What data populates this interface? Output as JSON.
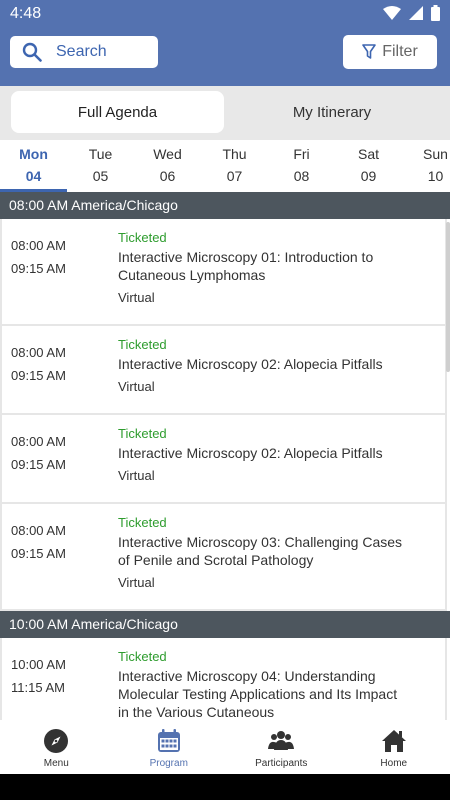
{
  "status_bar": {
    "time": "4:48"
  },
  "header": {
    "search_label": "Search",
    "filter_label": "Filter"
  },
  "segments": {
    "active": "Full Agenda",
    "inactive": "My Itinerary"
  },
  "days": [
    {
      "day": "Mon",
      "num": "04",
      "active": true
    },
    {
      "day": "Tue",
      "num": "05"
    },
    {
      "day": "Wed",
      "num": "06"
    },
    {
      "day": "Thu",
      "num": "07"
    },
    {
      "day": "Fri",
      "num": "08"
    },
    {
      "day": "Sat",
      "num": "09"
    },
    {
      "day": "Sun",
      "num": "10"
    }
  ],
  "groups": [
    {
      "header": "08:00 AM America/Chicago",
      "sessions": [
        {
          "start": "08:00 AM",
          "end": "09:15 AM",
          "status": "Ticketed",
          "title": "Interactive Microscopy 01: Introduction to Cutaneous Lymphomas",
          "location": "Virtual"
        },
        {
          "start": "08:00 AM",
          "end": "09:15 AM",
          "status": "Ticketed",
          "title": "Interactive Microscopy 02: Alopecia Pitfalls",
          "location": "Virtual"
        },
        {
          "start": "08:00 AM",
          "end": "09:15 AM",
          "status": "Ticketed",
          "title": "Interactive Microscopy 02: Alopecia Pitfalls",
          "location": "Virtual"
        },
        {
          "start": "08:00 AM",
          "end": "09:15 AM",
          "status": "Ticketed",
          "title": "Interactive Microscopy 03: Challenging Cases of Penile and Scrotal Pathology",
          "location": "Virtual"
        }
      ]
    },
    {
      "header": "10:00 AM America/Chicago",
      "sessions": [
        {
          "start": "10:00 AM",
          "end": "11:15 AM",
          "status": "Ticketed",
          "title": "Interactive Microscopy 04: Understanding Molecular Testing Applications and Its Impact in the Various Cutaneous",
          "location": ""
        }
      ]
    }
  ],
  "nav": [
    {
      "label": "Menu",
      "icon": "compass-icon"
    },
    {
      "label": "Program",
      "icon": "calendar-icon",
      "active": true
    },
    {
      "label": "Participants",
      "icon": "people-icon"
    },
    {
      "label": "Home",
      "icon": "home-icon"
    }
  ],
  "colors": {
    "header": "#5472b0",
    "accent": "#3d65b0",
    "ticketed": "#2e9c2e",
    "group_header": "#4d565e"
  }
}
